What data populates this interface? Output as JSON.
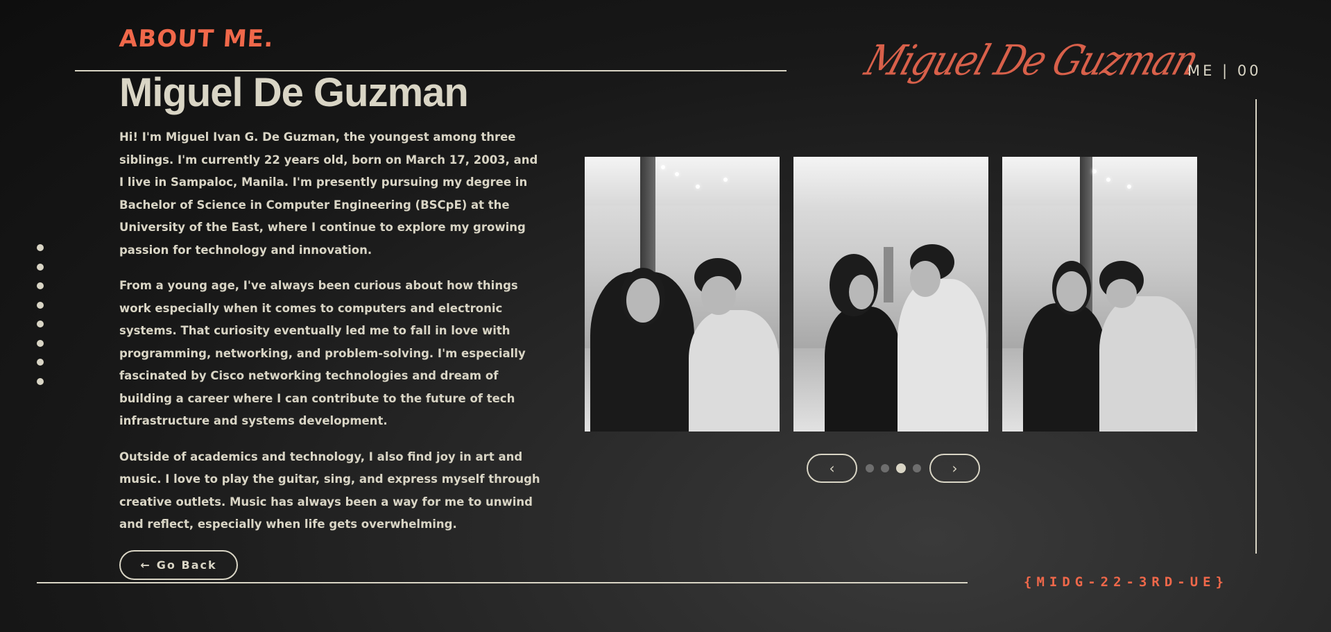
{
  "header": {
    "section_title": "ABOUT ME.",
    "signature": "Miguel De Guzman",
    "page_indicator": "ME | 00"
  },
  "profile": {
    "name": "Miguel De Guzman",
    "bio": [
      "Hi! I'm Miguel Ivan G. De Guzman, the youngest among three siblings. I'm currently 22 years old, born on March 17, 2003, and I live in Sampaloc, Manila. I'm presently pursuing my degree in Bachelor of Science in Computer Engineering (BSCpE) at the University of the East, where I continue to explore my growing passion for technology and innovation.",
      "From a young age, I've always been curious about how things work especially when it comes to computers and electronic systems. That curiosity eventually led me to fall in love with programming, networking, and problem-solving. I'm especially fascinated by Cisco networking technologies and dream of building a career where I can contribute to the future of tech infrastructure and systems development.",
      "Outside of academics and technology, I also find joy in art and music. I love to play the guitar, sing, and express myself through creative outlets. Music has always been a way for me to unwind and reflect, especially when life gets overwhelming."
    ]
  },
  "buttons": {
    "go_back_arrow": "←",
    "go_back_label": "Go Back",
    "prev_icon": "‹",
    "next_icon": "›"
  },
  "carousel": {
    "slide_count": 4,
    "active_index": 2
  },
  "side_nav": {
    "dot_count": 8
  },
  "footer": {
    "code": "{MIDG-22-3RD-UE}"
  },
  "colors": {
    "accent": "#f0684a",
    "text": "#d9d5c5",
    "background": "#1a1a1a"
  }
}
